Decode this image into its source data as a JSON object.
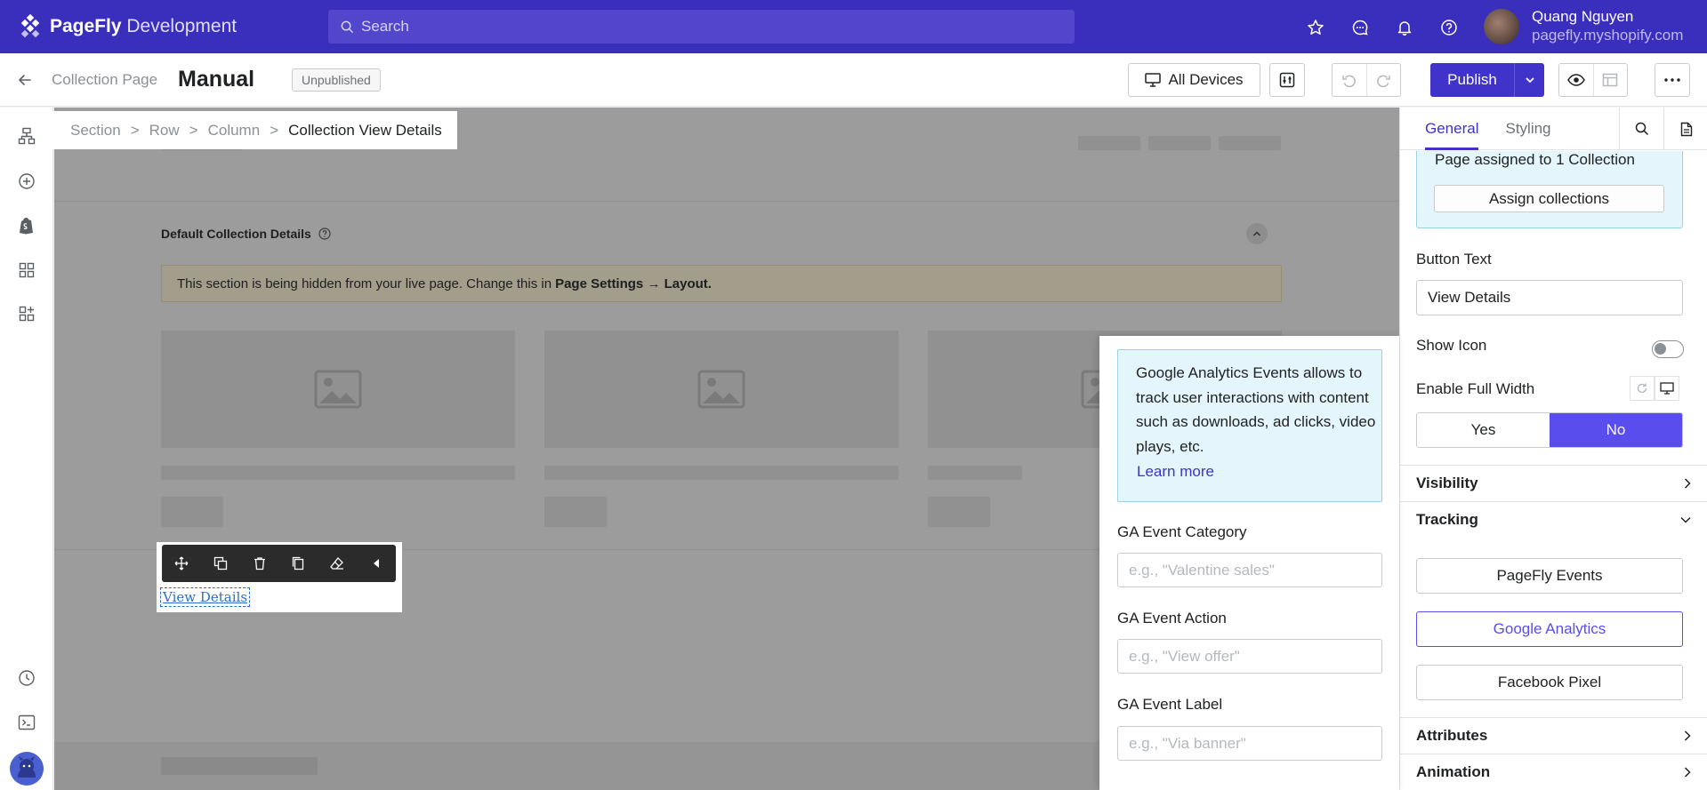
{
  "app": {
    "brand_bold": "PageFly",
    "brand_suffix": " Development",
    "search_placeholder": "Search",
    "user_name": "Quang Nguyen",
    "user_store": "pagefly.myshopify.com"
  },
  "page": {
    "type": "Collection Page",
    "name": "Manual",
    "status": "Unpublished",
    "devices_label": "All Devices",
    "publish_label": "Publish"
  },
  "breadcrumb": [
    "Section",
    "Row",
    "Column",
    "Collection View Details"
  ],
  "canvas": {
    "section_title": "Default Collection Details",
    "notice_text": "This section is being hidden from your live page. Change this in",
    "notice_bold": "Page Settings → Layout.",
    "element_text": "View Details"
  },
  "inspector": {
    "tabs": [
      "General",
      "Styling"
    ],
    "active_tab": "General",
    "assign_text": "Page assigned to 1 Collection",
    "assign_button": "Assign collections",
    "button_text_label": "Button Text",
    "button_text_value": "View Details",
    "show_icon_label": "Show Icon",
    "show_icon_on": false,
    "full_width_label": "Enable Full Width",
    "full_width_options": [
      "Yes",
      "No"
    ],
    "full_width_selected": "No",
    "sections": {
      "visibility": "Visibility",
      "tracking": "Tracking",
      "attributes": "Attributes",
      "animation": "Animation"
    },
    "tracking_buttons": [
      "PageFly Events",
      "Google Analytics",
      "Facebook Pixel"
    ],
    "tracking_selected": "Google Analytics"
  },
  "ga_popover": {
    "info": "Google Analytics Events allows to track user interactions with content such as downloads, ad clicks, video plays, etc.",
    "learn_more": "Learn more",
    "category_label": "GA Event Category",
    "category_placeholder": "e.g., \"Valentine sales\"",
    "action_label": "GA Event Action",
    "action_placeholder": "e.g., \"View offer\"",
    "label_label": "GA Event Label",
    "label_placeholder": "e.g., \"Via banner\""
  },
  "colors": {
    "brand": "#3a2ebd",
    "accent": "#5a4dee",
    "info_bg": "#e4f5fb"
  },
  "icons": {
    "logo": "pagefly-logo-icon",
    "search": "search-icon",
    "star": "star-icon",
    "chat": "chat-icon",
    "bell": "bell-icon",
    "help": "help-icon",
    "back": "arrow-left-icon",
    "monitor": "monitor-icon",
    "settings": "sliders-icon",
    "undo": "undo-icon",
    "redo": "redo-icon",
    "chevron_down": "chevron-down-icon",
    "eye": "eye-icon",
    "layout": "layout-icon",
    "more": "more-horizontal-icon"
  }
}
